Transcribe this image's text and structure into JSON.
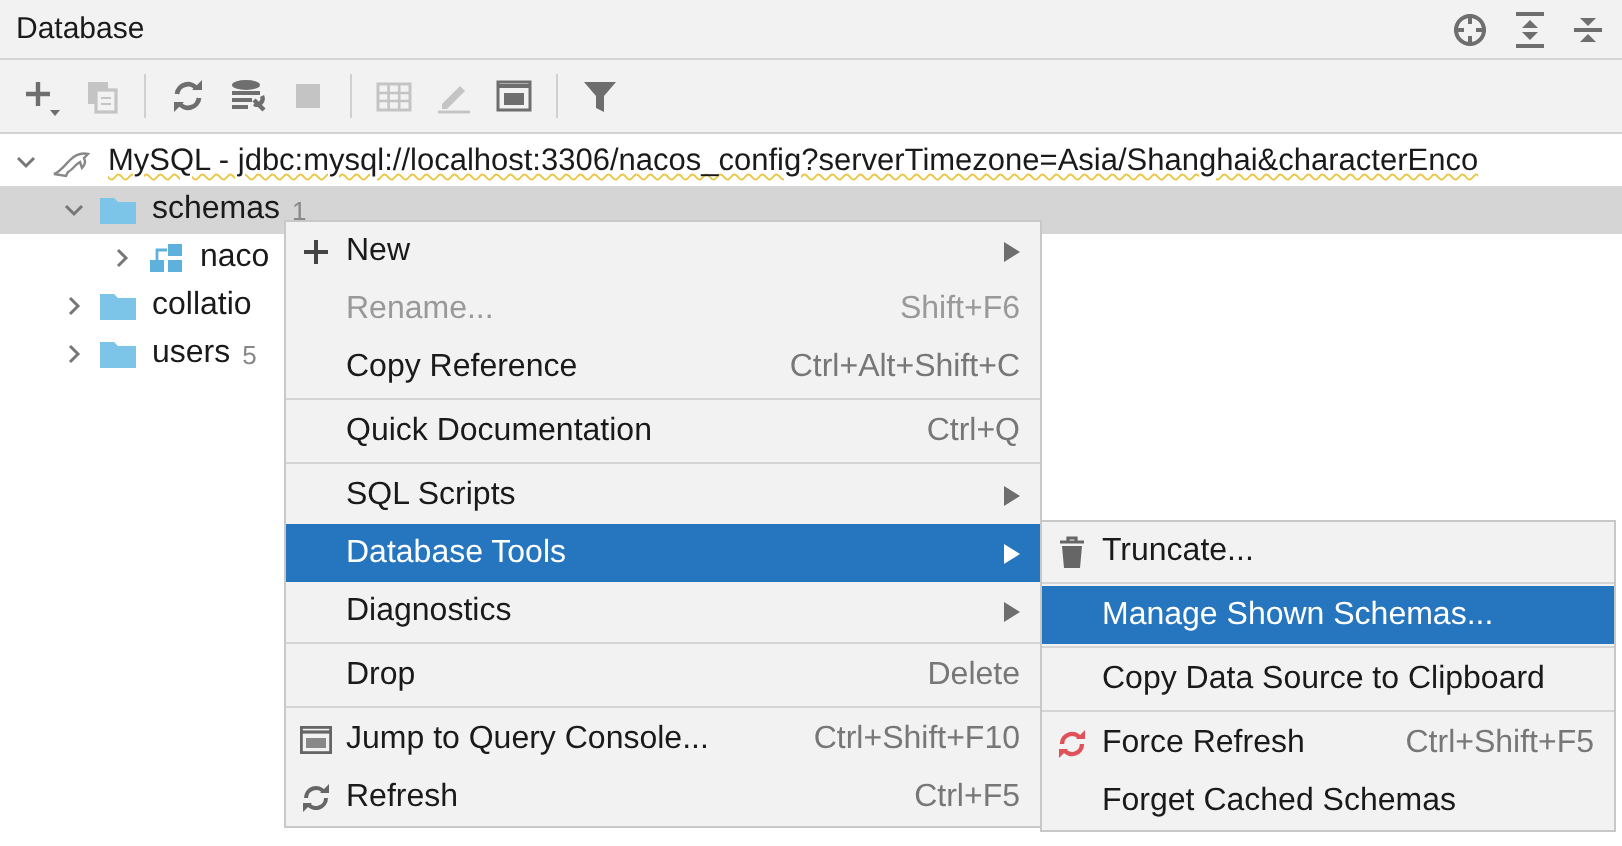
{
  "panel": {
    "title": "Database"
  },
  "toolbar": [
    {
      "disabled": false
    },
    {
      "disabled": true
    },
    {
      "disabled": false
    },
    {
      "disabled": false
    },
    {
      "disabled": true
    },
    {
      "disabled": true
    },
    {
      "disabled": true
    },
    {
      "disabled": false
    },
    {
      "disabled": false
    }
  ],
  "tree": [
    {
      "label": "MySQL - jdbc:mysql://localhost:3306/nacos_config?serverTimezone=Asia/Shanghai&characterEnco",
      "expanded": true,
      "selected": false,
      "children": [
        {
          "label": "schemas",
          "count": "1",
          "expanded": true,
          "selected": true,
          "children": [
            {
              "label": "naco",
              "expanded": false,
              "selected": false
            }
          ]
        },
        {
          "label": "collatio",
          "expanded": false,
          "selected": false
        },
        {
          "label": "users",
          "count": "5",
          "expanded": false,
          "selected": false
        }
      ]
    }
  ],
  "context_menu": {
    "groups": [
      [
        {
          "label": "New",
          "has_submenu": true,
          "disabled": false,
          "selected": false
        },
        {
          "label": "Rename...",
          "shortcut": "Shift+F6",
          "disabled": true,
          "selected": false
        },
        {
          "label": "Copy Reference",
          "shortcut": "Ctrl+Alt+Shift+C",
          "disabled": false,
          "selected": false
        }
      ],
      [
        {
          "label": "Quick Documentation",
          "shortcut": "Ctrl+Q",
          "disabled": false,
          "selected": false
        }
      ],
      [
        {
          "label": "SQL Scripts",
          "has_submenu": true,
          "disabled": false,
          "selected": false
        },
        {
          "label": "Database Tools",
          "has_submenu": true,
          "disabled": false,
          "selected": true,
          "submenu": {
            "groups": [
              [
                {
                  "label": "Truncate...",
                  "disabled": false,
                  "selected": false
                }
              ],
              [
                {
                  "label": "Manage Shown Schemas...",
                  "disabled": false,
                  "selected": true
                }
              ],
              [
                {
                  "label": "Copy Data Source to Clipboard",
                  "disabled": false,
                  "selected": false
                }
              ],
              [
                {
                  "label": "Force Refresh",
                  "shortcut": "Ctrl+Shift+F5",
                  "disabled": false,
                  "selected": false
                },
                {
                  "label": "Forget Cached Schemas",
                  "disabled": false,
                  "selected": false
                }
              ]
            ]
          }
        },
        {
          "label": "Diagnostics",
          "has_submenu": true,
          "disabled": false,
          "selected": false
        }
      ],
      [
        {
          "label": "Drop",
          "shortcut": "Delete",
          "disabled": false,
          "selected": false
        }
      ],
      [
        {
          "label": "Jump to Query Console...",
          "shortcut": "Ctrl+Shift+F10",
          "disabled": false,
          "selected": false
        },
        {
          "label": "Refresh",
          "shortcut": "Ctrl+F5",
          "disabled": false,
          "selected": false
        }
      ]
    ]
  }
}
